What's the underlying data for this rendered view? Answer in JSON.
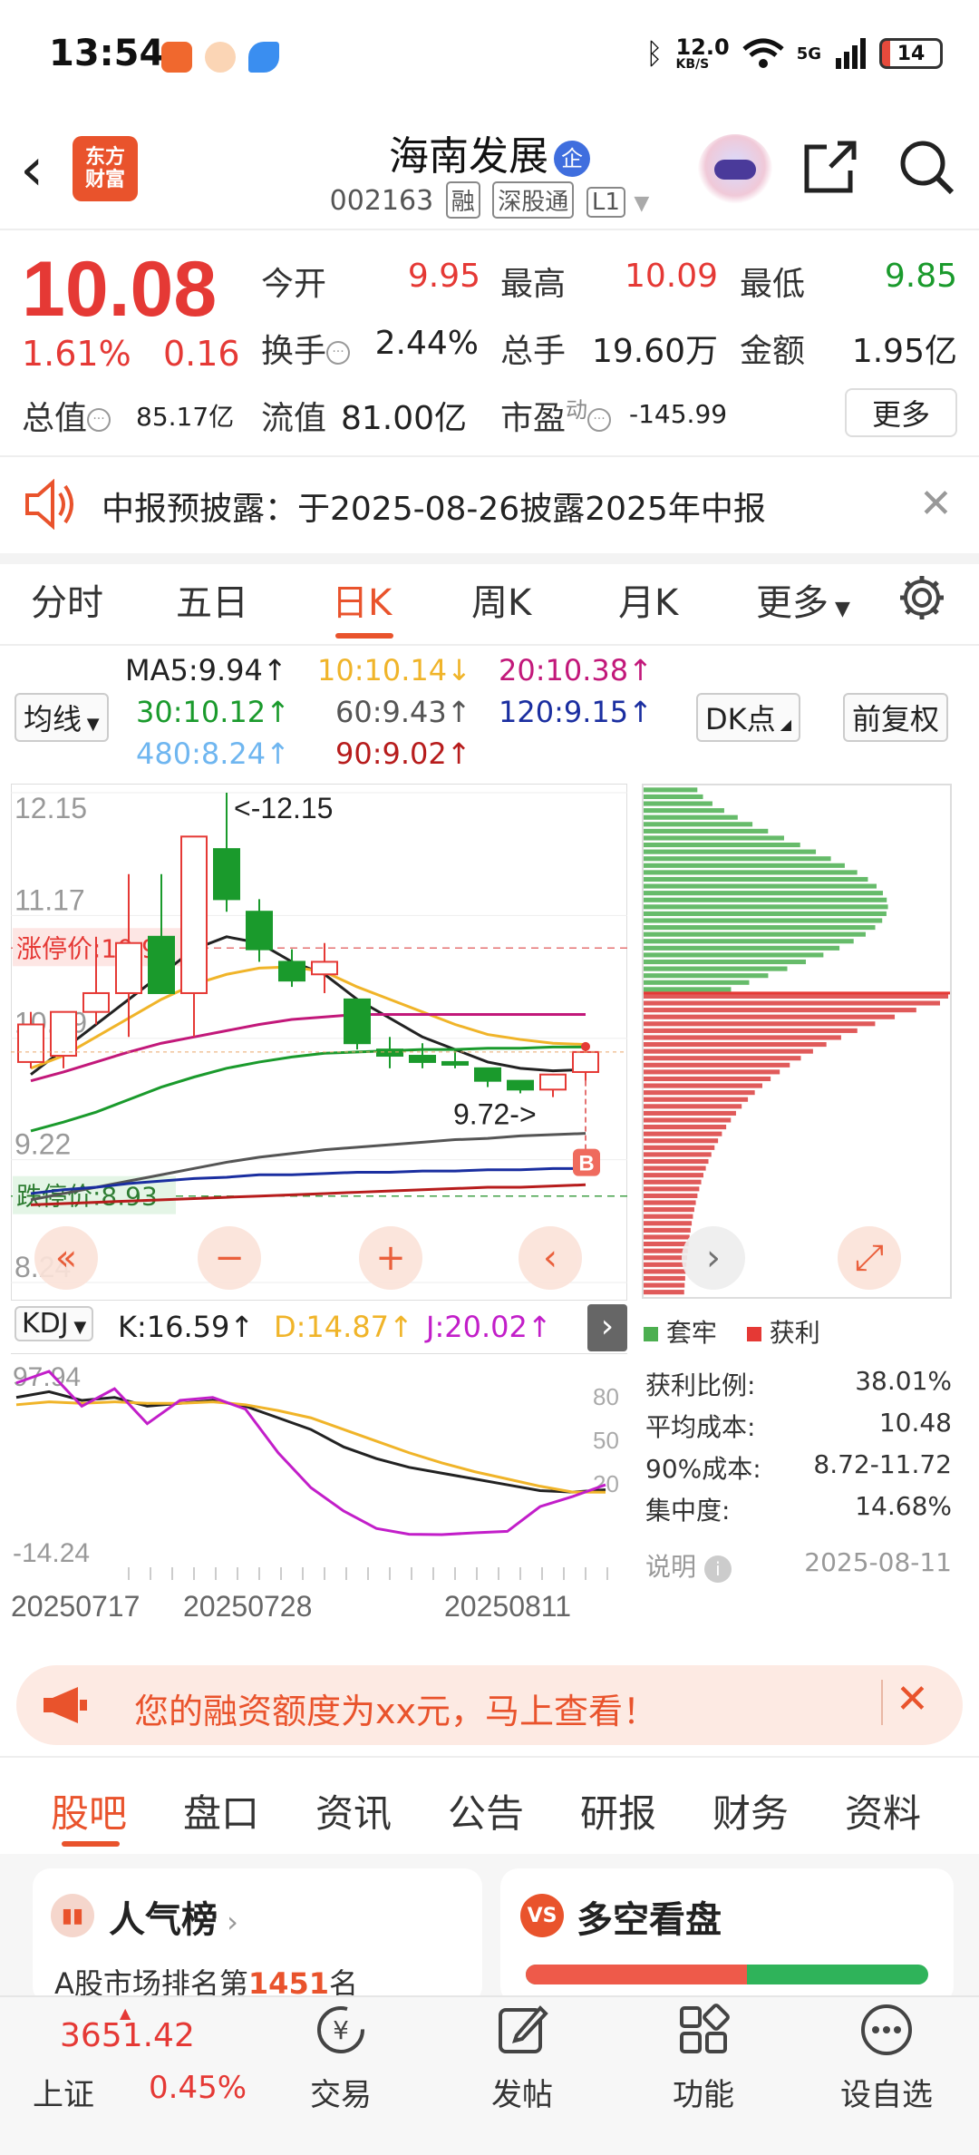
{
  "status_bar": {
    "time": "13:54",
    "net_speed": "12.0",
    "net_unit": "KB/S",
    "signal": "5G",
    "battery": "14"
  },
  "header": {
    "back_icon": "back-arrow-icon",
    "logo_line1": "东方",
    "logo_line2": "财富",
    "title": "海南发展",
    "title_badge": "企",
    "code": "002163",
    "tag1": "融",
    "tag2": "深股通",
    "tag3": "L1"
  },
  "quote": {
    "price": "10.08",
    "change_pct": "1.61%",
    "change": "0.16",
    "open_label": "今开",
    "open": "9.95",
    "high_label": "最高",
    "high": "10.09",
    "low_label": "最低",
    "low": "9.85",
    "turnover_label": "换手",
    "turnover": "2.44%",
    "volume_label": "总手",
    "volume": "19.60万",
    "amount_label": "金额",
    "amount": "1.95亿",
    "mktcap_label": "总值",
    "mktcap": "85.17亿",
    "float_label": "流值",
    "float": "81.00亿",
    "pe_label": "市盈",
    "pe_sup": "动",
    "pe": "-145.99",
    "more": "更多"
  },
  "notice": {
    "text": "中报预披露：于2025-08-26披露2025年中报"
  },
  "tabs": [
    "分时",
    "五日",
    "日K",
    "周K",
    "月K",
    "更多"
  ],
  "ma_legend": {
    "selector": "均线",
    "ma5": "MA5:9.94↑",
    "ma10": "10:10.14↓",
    "ma20": "20:10.38↑",
    "ma30": "30:10.12↑",
    "ma60": "60:9.43↑",
    "ma120": "120:9.15↑",
    "ma480": "480:8.24↑",
    "ma90": "90:9.02↑",
    "dk_btn": "DK点",
    "adj_btn": "前复权",
    "colors": {
      "ma5": "#222222",
      "ma10": "#f0b429",
      "ma20": "#c2187a",
      "ma30": "#1a9a2c",
      "ma60": "#555555",
      "ma120": "#1a2ea0",
      "ma480": "#6fb6f0",
      "ma90": "#b71c1c"
    }
  },
  "chart_data": [
    {
      "type": "candlestick",
      "y_ticks": [
        "12.15",
        "11.17",
        "10.19",
        "9.22",
        "8.24"
      ],
      "ylim": [
        8.24,
        12.15
      ],
      "limit_up_label": "涨停价:10.91",
      "limit_up": 10.91,
      "limit_down_label": "跌停价:8.93",
      "limit_down": 8.93,
      "high_annotation": "<-12.15",
      "low_annotation": "9.72->",
      "buy_marker": "B",
      "candles": [
        {
          "o": 10.0,
          "h": 10.4,
          "l": 9.95,
          "c": 10.3
        },
        {
          "o": 10.05,
          "h": 10.4,
          "l": 9.95,
          "c": 10.4
        },
        {
          "o": 10.4,
          "h": 11.0,
          "l": 10.3,
          "c": 10.55
        },
        {
          "o": 10.55,
          "h": 11.5,
          "l": 10.2,
          "c": 10.95
        },
        {
          "o": 11.0,
          "h": 11.5,
          "l": 10.9,
          "c": 10.55
        },
        {
          "o": 10.55,
          "h": 11.5,
          "l": 10.2,
          "c": 11.8
        },
        {
          "o": 11.7,
          "h": 12.15,
          "l": 11.2,
          "c": 11.3
        },
        {
          "o": 11.2,
          "h": 11.3,
          "l": 10.8,
          "c": 10.9
        },
        {
          "o": 10.8,
          "h": 10.9,
          "l": 10.6,
          "c": 10.65
        },
        {
          "o": 10.7,
          "h": 10.95,
          "l": 10.55,
          "c": 10.8
        },
        {
          "o": 10.5,
          "h": 10.5,
          "l": 10.1,
          "c": 10.15
        },
        {
          "o": 10.1,
          "h": 10.2,
          "l": 9.95,
          "c": 10.05
        },
        {
          "o": 10.05,
          "h": 10.15,
          "l": 9.95,
          "c": 10.0
        },
        {
          "o": 10.0,
          "h": 10.1,
          "l": 9.95,
          "c": 9.98
        },
        {
          "o": 9.95,
          "h": 9.95,
          "l": 9.8,
          "c": 9.85
        },
        {
          "o": 9.85,
          "h": 9.85,
          "l": 9.75,
          "c": 9.78
        },
        {
          "o": 9.78,
          "h": 9.9,
          "l": 9.72,
          "c": 9.9
        },
        {
          "o": 9.92,
          "h": 10.09,
          "l": 9.85,
          "c": 10.08
        }
      ],
      "ma_series": [
        {
          "key": "ma5",
          "values": [
            9.9,
            10.1,
            10.3,
            10.5,
            10.7,
            10.9,
            11.0,
            10.95,
            10.8,
            10.7,
            10.5,
            10.35,
            10.2,
            10.1,
            10.0,
            9.95,
            9.93,
            9.94
          ]
        },
        {
          "key": "ma10",
          "values": [
            9.95,
            10.05,
            10.2,
            10.35,
            10.5,
            10.62,
            10.7,
            10.75,
            10.76,
            10.72,
            10.6,
            10.5,
            10.4,
            10.3,
            10.22,
            10.18,
            10.15,
            10.14
          ]
        },
        {
          "key": "ma20",
          "values": [
            9.85,
            9.92,
            10.0,
            10.08,
            10.15,
            10.2,
            10.25,
            10.3,
            10.34,
            10.36,
            10.38,
            10.38,
            10.38,
            10.38,
            10.38,
            10.38,
            10.38,
            10.38
          ]
        },
        {
          "key": "ma30",
          "values": [
            9.45,
            9.52,
            9.6,
            9.7,
            9.8,
            9.88,
            9.95,
            10.0,
            10.04,
            10.07,
            10.08,
            10.09,
            10.1,
            10.1,
            10.11,
            10.11,
            10.12,
            10.12
          ]
        },
        {
          "key": "ma60",
          "values": [
            8.9,
            8.95,
            9.0,
            9.05,
            9.1,
            9.15,
            9.2,
            9.24,
            9.27,
            9.3,
            9.32,
            9.34,
            9.36,
            9.38,
            9.39,
            9.41,
            9.42,
            9.43
          ]
        },
        {
          "key": "ma120",
          "values": [
            8.95,
            8.98,
            9.0,
            9.03,
            9.05,
            9.07,
            9.08,
            9.1,
            9.1,
            9.11,
            9.12,
            9.12,
            9.13,
            9.13,
            9.14,
            9.14,
            9.15,
            9.15
          ]
        },
        {
          "key": "ma90",
          "values": [
            8.86,
            8.87,
            8.88,
            8.89,
            8.9,
            8.91,
            8.92,
            8.93,
            8.94,
            8.95,
            8.96,
            8.97,
            8.98,
            8.99,
            9.0,
            9.0,
            9.01,
            9.02
          ]
        }
      ]
    },
    {
      "type": "line",
      "indicator": "KDJ",
      "y_ticks": [
        "97.94",
        "-14.24"
      ],
      "right_ticks": [
        "80",
        "50",
        "20"
      ],
      "ylim": [
        -14.24,
        97.94
      ],
      "x_labels": [
        "20250717",
        "20250728",
        "20250811"
      ],
      "series": [
        {
          "name": "K",
          "value_label": "K:16.59↑",
          "color": "#222222",
          "values": [
            80,
            84,
            78,
            80,
            74,
            76,
            78,
            74,
            66,
            58,
            46,
            38,
            32,
            28,
            24,
            20,
            16,
            15,
            16.59
          ]
        },
        {
          "name": "D",
          "value_label": "D:14.87↑",
          "color": "#f0b429",
          "values": [
            75,
            77,
            76,
            77,
            76,
            76,
            77,
            75,
            71,
            66,
            58,
            50,
            42,
            35,
            29,
            24,
            19,
            15,
            14.87
          ]
        },
        {
          "name": "J",
          "value_label": "J:20.02↑",
          "color": "#c21ec9",
          "values": [
            90,
            97.94,
            74,
            86,
            62,
            78,
            80,
            72,
            42,
            18,
            2,
            -10,
            -14,
            -14.24,
            -13,
            -12,
            5,
            12,
            20.02
          ]
        }
      ]
    }
  ],
  "chips": {
    "legend_lose": "套牢",
    "legend_win": "获利",
    "profit_ratio_label": "获利比例:",
    "profit_ratio": "38.01%",
    "avg_cost_label": "平均成本:",
    "avg_cost": "10.48",
    "cost90_label": "90%成本:",
    "cost90": "8.72-11.72",
    "concentration_label": "集中度:",
    "concentration": "14.68%",
    "explain": "说明",
    "date": "2025-08-11"
  },
  "kdj_selector": "KDJ",
  "promo": {
    "text": "您的融资额度为xx元，马上查看！"
  },
  "bottom_tabs": [
    "股吧",
    "盘口",
    "资讯",
    "公告",
    "研报",
    "财务",
    "资料"
  ],
  "cards": {
    "popularity_title": "人气榜",
    "popularity_text_pre": "A股市场排名第",
    "popularity_rank": "1451",
    "popularity_text_post": "名",
    "longshort_title": "多空看盘",
    "longshort_icon": "VS",
    "long_ratio": 0.55
  },
  "bottom_nav": {
    "index_value": "3651.42",
    "index_name": "上证",
    "index_change": "0.45%",
    "trade": "交易",
    "post": "发帖",
    "func": "功能",
    "watch": "设自选"
  }
}
